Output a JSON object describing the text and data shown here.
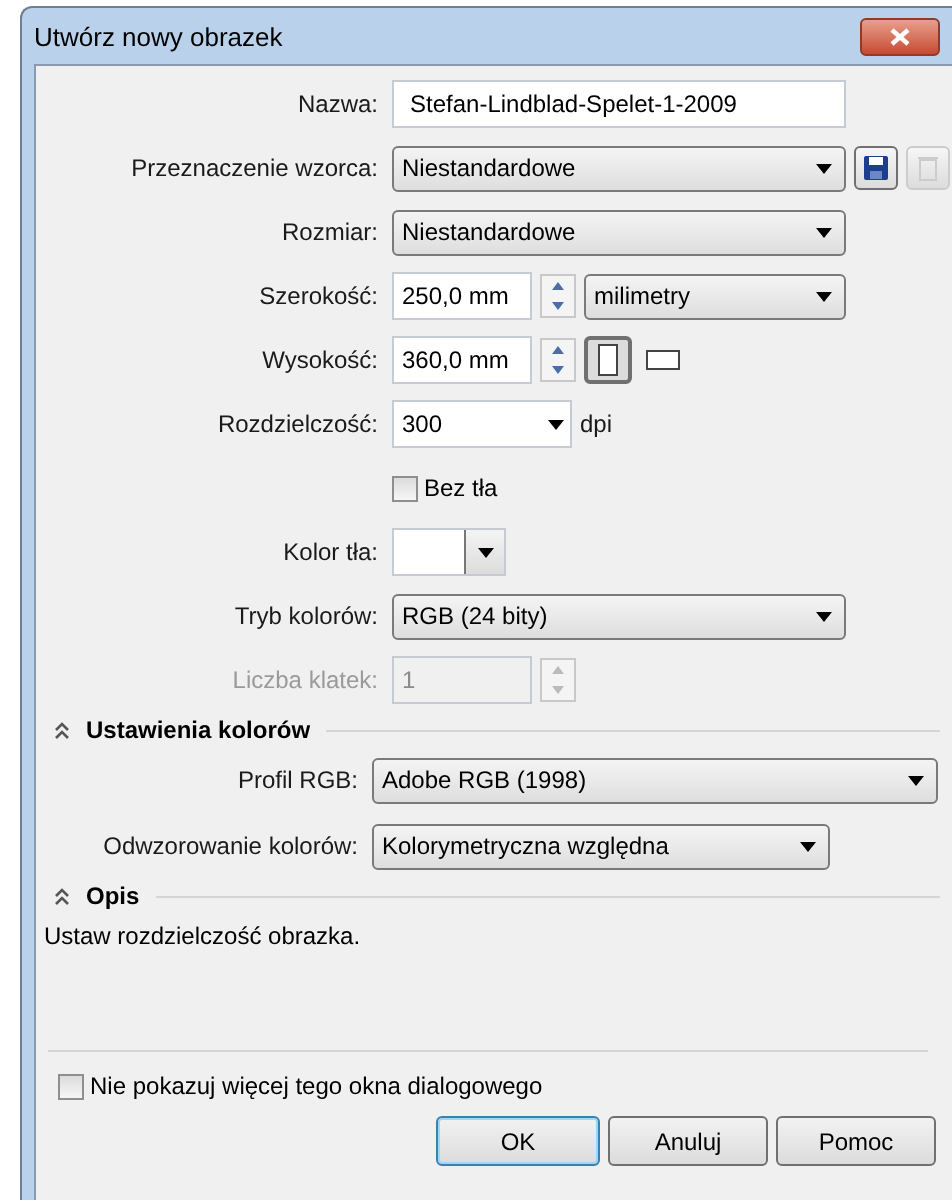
{
  "window": {
    "title": "Utwórz nowy obrazek"
  },
  "rows": [
    {
      "kind": "text",
      "label": "Nazwa:",
      "value": "Stefan-Lindblad-Spelet-1-2009"
    },
    {
      "kind": "preset",
      "label": "Przeznaczenie wzorca:",
      "value": "Niestandardowe",
      "delete_disabled": true
    },
    {
      "kind": "select",
      "label": "Rozmiar:",
      "value": "Niestandardowe"
    },
    {
      "kind": "dimension",
      "label": "Szerokość:",
      "value": "250,0 mm",
      "unit": "milimetry"
    },
    {
      "kind": "orientation",
      "label": "Wysokość:",
      "value": "360,0 mm",
      "orientations": [
        {
          "kind": "portrait",
          "selected": true
        },
        {
          "kind": "landscape",
          "selected": false
        }
      ]
    },
    {
      "kind": "combo",
      "label": "Rozdzielczość:",
      "value": "300",
      "suffix": "dpi"
    },
    {
      "kind": "checkbox",
      "label": "Bez tła",
      "checked": false
    },
    {
      "kind": "color",
      "label": "Kolor tła:",
      "color": "#ffffff"
    },
    {
      "kind": "select",
      "label": "Tryb kolorów:",
      "value": "RGB (24 bity)"
    },
    {
      "kind": "spinner",
      "label": "Liczba klatek:",
      "value": "1",
      "disabled": true
    }
  ],
  "sections": [
    {
      "title": "Ustawienia kolorów",
      "expanded": true,
      "rows": [
        {
          "label": "Profil RGB:",
          "value": "Adobe RGB (1998)",
          "wide": true
        },
        {
          "label": "Odwzorowanie kolorów:",
          "value": "Kolorymetryczna względna",
          "wide": false
        }
      ]
    },
    {
      "title": "Opis",
      "expanded": true,
      "text": "Ustaw rozdzielczość obrazka."
    }
  ],
  "dont_show": {
    "label": "Nie pokazuj więcej tego okna dialogowego",
    "checked": false
  },
  "buttons": [
    {
      "label": "OK",
      "default": true
    },
    {
      "label": "Anuluj",
      "default": false
    },
    {
      "label": "Pomoc",
      "default": false
    }
  ]
}
